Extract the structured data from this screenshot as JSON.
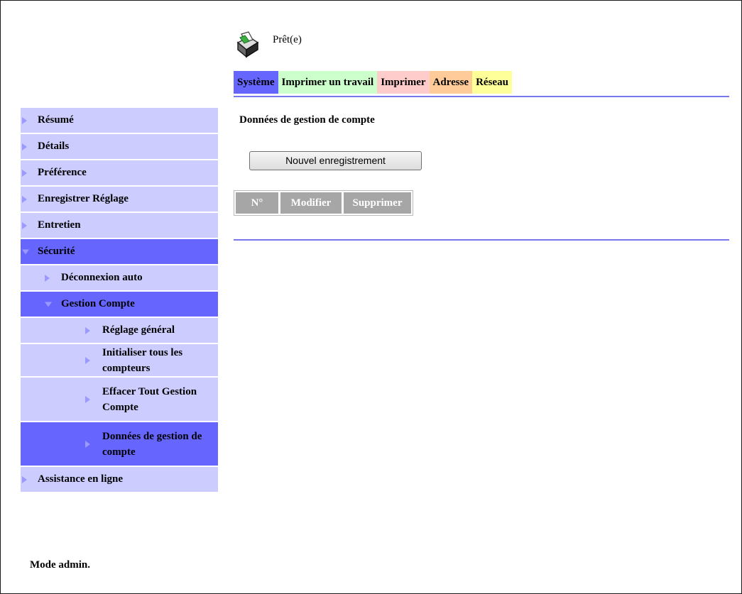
{
  "status": {
    "text": "Prêt(e)",
    "icon": "printer-icon"
  },
  "tabs": [
    "Système",
    "Imprimer un travail",
    "Imprimer",
    "Adresse",
    "Réseau"
  ],
  "sidebar": {
    "items": [
      {
        "label": "Résumé"
      },
      {
        "label": "Détails"
      },
      {
        "label": "Préférence"
      },
      {
        "label": "Enregistrer Réglage"
      },
      {
        "label": "Entretien"
      },
      {
        "label": "Sécurité"
      },
      {
        "label": "Déconnexion auto"
      },
      {
        "label": "Gestion Compte"
      },
      {
        "label": "Réglage général"
      },
      {
        "label": "Initialiser tous les compteurs"
      },
      {
        "label": "Effacer Tout Gestion Compte"
      },
      {
        "label": "Données de gestion de compte"
      },
      {
        "label": "Assistance en ligne"
      }
    ]
  },
  "main": {
    "heading": "Données de gestion de compte",
    "new_button": "Nouvel enregistrement",
    "table_headers": [
      "N°",
      "Modifier",
      "Supprimer"
    ]
  },
  "footer": {
    "mode": "Mode admin."
  },
  "colors": {
    "active_tab": "#6666ff",
    "nav_bg": "#ccccff",
    "nav_active": "#6666ff",
    "divider": "#7777ee"
  }
}
